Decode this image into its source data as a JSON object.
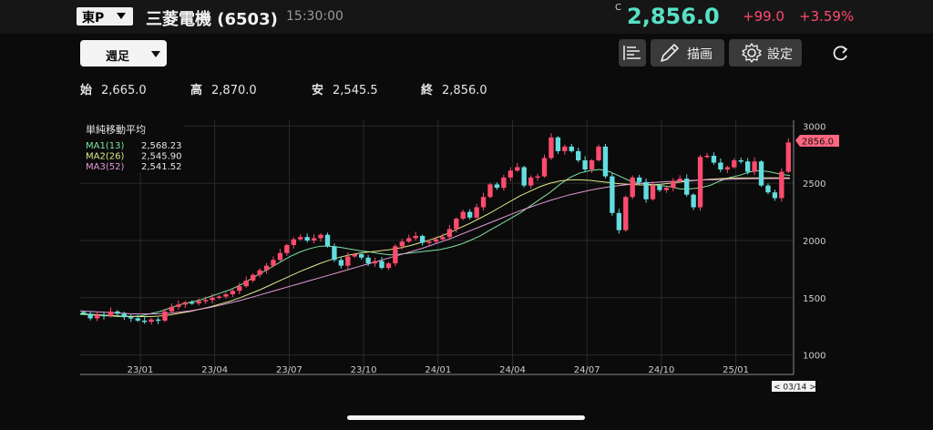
{
  "header": {
    "market": "東P",
    "stock_name": "三菱電機 (6503)",
    "time": "15:30:00",
    "price_mark": "C",
    "price": "2,856.0",
    "change": "+99.0",
    "change_pct": "+3.59%"
  },
  "toolbar": {
    "period": "週足",
    "draw_label": "描画",
    "settings_label": "設定",
    "icons": [
      "menu-lines-icon",
      "pencil-icon",
      "gear-icon",
      "refresh-icon"
    ]
  },
  "ohlc": {
    "open_label": "始",
    "open": "2,665.0",
    "high_label": "高",
    "high": "2,870.0",
    "low_label": "安",
    "low": "2,545.5",
    "close_label": "終",
    "close": "2,856.0"
  },
  "legend": {
    "title": "単純移動平均",
    "items": [
      {
        "name": "MA1(13)",
        "value": "2,568.23",
        "color": "#7ee3a1"
      },
      {
        "name": "MA2(26)",
        "value": "2,545.90",
        "color": "#dfe98a"
      },
      {
        "name": "MA3(52)",
        "value": "2,541.52",
        "color": "#e39ad9"
      }
    ]
  },
  "colors": {
    "up": "#ff4b6e",
    "down": "#63dde0",
    "price": "#58e0c4"
  },
  "chart_data": {
    "type": "candlestick",
    "ylim": [
      830,
      3050
    ],
    "yticks": [
      3000,
      2500,
      2000,
      1500,
      1000
    ],
    "xticks": [
      "23/01",
      "23/04",
      "23/07",
      "23/10",
      "24/01",
      "24/04",
      "24/07",
      "24/10",
      "25/01"
    ],
    "last_price_label": "2856.0",
    "cursor_label": "< 03/14 >",
    "closes": [
      1360,
      1320,
      1350,
      1340,
      1380,
      1360,
      1330,
      1320,
      1300,
      1290,
      1310,
      1300,
      1380,
      1420,
      1440,
      1460,
      1450,
      1470,
      1480,
      1500,
      1510,
      1530,
      1560,
      1600,
      1650,
      1700,
      1740,
      1780,
      1830,
      1890,
      1960,
      2010,
      2030,
      2000,
      2020,
      2050,
      1950,
      1830,
      1780,
      1860,
      1880,
      1850,
      1800,
      1820,
      1760,
      1800,
      1950,
      1990,
      2020,
      2040,
      1980,
      1990,
      2010,
      2030,
      2100,
      2190,
      2250,
      2200,
      2290,
      2380,
      2490,
      2460,
      2550,
      2610,
      2640,
      2480,
      2550,
      2560,
      2720,
      2900,
      2780,
      2820,
      2780,
      2700,
      2620,
      2700,
      2820,
      2560,
      2240,
      2090,
      2380,
      2550,
      2510,
      2360,
      2480,
      2440,
      2460,
      2520,
      2540,
      2400,
      2290,
      2730,
      2740,
      2680,
      2620,
      2640,
      2700,
      2690,
      2600,
      2690,
      2480,
      2420,
      2370,
      2600,
      2856
    ],
    "moving_averages": [
      {
        "name": "MA1(13)",
        "values": [
          1355,
          1350,
          1345,
          1340,
          1335,
          1335,
          1340,
          1360,
          1380,
          1410,
          1440,
          1460,
          1480,
          1510,
          1540,
          1570,
          1610,
          1660,
          1710,
          1760,
          1810,
          1860,
          1900,
          1930,
          1950,
          1950,
          1940,
          1925,
          1910,
          1900,
          1885,
          1875,
          1880,
          1890,
          1900,
          1910,
          1920,
          1940,
          1965,
          2000,
          2040,
          2090,
          2140,
          2190,
          2240,
          2300,
          2360,
          2420,
          2490,
          2550,
          2590,
          2610,
          2620,
          2600,
          2560,
          2520,
          2500,
          2490,
          2480,
          2470,
          2450,
          2450,
          2460,
          2480,
          2520,
          2550,
          2570,
          2600,
          2610,
          2600,
          2580,
          2568
        ]
      },
      {
        "name": "MA2(26)",
        "values": [
          1360,
          1355,
          1350,
          1345,
          1340,
          1338,
          1335,
          1335,
          1340,
          1350,
          1365,
          1380,
          1400,
          1420,
          1445,
          1470,
          1500,
          1535,
          1570,
          1610,
          1650,
          1690,
          1730,
          1765,
          1800,
          1830,
          1855,
          1875,
          1890,
          1900,
          1910,
          1920,
          1935,
          1955,
          1980,
          2005,
          2035,
          2070,
          2110,
          2150,
          2195,
          2240,
          2290,
          2340,
          2390,
          2430,
          2470,
          2500,
          2520,
          2530,
          2530,
          2525,
          2515,
          2505,
          2495,
          2490,
          2485,
          2485,
          2490,
          2500,
          2510,
          2520,
          2528,
          2535,
          2540,
          2545,
          2546,
          2546,
          2546,
          2546,
          2546,
          2546
        ]
      },
      {
        "name": "MA3(52)",
        "values": [
          1385,
          1380,
          1375,
          1370,
          1365,
          1360,
          1358,
          1358,
          1360,
          1365,
          1375,
          1385,
          1400,
          1415,
          1435,
          1455,
          1475,
          1500,
          1525,
          1550,
          1575,
          1600,
          1625,
          1650,
          1675,
          1700,
          1725,
          1750,
          1775,
          1800,
          1825,
          1850,
          1875,
          1900,
          1925,
          1955,
          1985,
          2015,
          2050,
          2085,
          2120,
          2155,
          2190,
          2225,
          2260,
          2290,
          2320,
          2350,
          2375,
          2400,
          2420,
          2440,
          2455,
          2470,
          2480,
          2490,
          2498,
          2505,
          2510,
          2515,
          2520,
          2524,
          2528,
          2530,
          2532,
          2535,
          2537,
          2539,
          2540,
          2541,
          2541,
          2541
        ]
      }
    ]
  }
}
